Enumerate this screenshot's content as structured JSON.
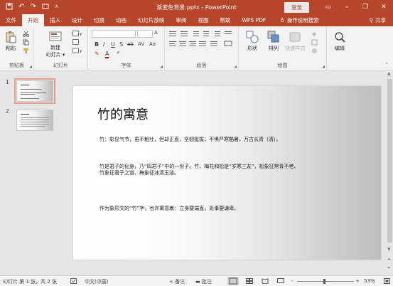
{
  "titlebar": {
    "title": "渐变色背景.pptx - PowerPoint",
    "login_label": "登录",
    "icons": [
      "save-icon",
      "undo-icon",
      "redo-icon",
      "present-icon",
      "customize-icon"
    ],
    "window_buttons": [
      "ribbon-options",
      "minimize",
      "restore",
      "close"
    ]
  },
  "tabs": [
    "文件",
    "开始",
    "插入",
    "设计",
    "切换",
    "动画",
    "幻灯片放映",
    "审阅",
    "视图",
    "帮助",
    "WPS PDF"
  ],
  "active_tab": "开始",
  "search_label": "操作说明搜索",
  "share_label": "共享",
  "ribbon": {
    "clipboard": {
      "paste": "粘贴",
      "label": "剪贴板"
    },
    "slides": {
      "new_slide_line1": "新建",
      "new_slide_line2": "幻灯片 ▾",
      "label": "幻灯片"
    },
    "font": {
      "label": "字体",
      "buttons": [
        "B",
        "I",
        "U",
        "S",
        "ab",
        "AV",
        "Aa",
        "A",
        "A"
      ]
    },
    "paragraph": {
      "label": "段落"
    },
    "drawing": {
      "shapes": "形状",
      "arrange": "排列",
      "quick_styles": "快速样式",
      "label": "绘图"
    },
    "editing": {
      "edit": "编辑"
    }
  },
  "thumbnails": [
    {
      "number": "1",
      "selected": true
    },
    {
      "number": "2",
      "selected": false
    }
  ],
  "slide": {
    "title": "竹的寓意",
    "paragraphs": [
      "竹：彰显气节，虽不粗壮，但却正直，坚韧挺拔；不惧严寒酷暑，万古长青（清）。",
      "竹是君子的化身，乃“四君子”中的一份子。竹、梅花和松是“岁寒三友”，松象征常青不老、",
      "竹象征君子之道、梅象征冰清玉洁。",
      "作为象形文的“竹”字，也许寓意着：立身要端直，处事要谦卑。"
    ]
  },
  "statusbar": {
    "slide_info": "幻灯片 第 1 张，共 2 张",
    "language": "中文(中国)",
    "notes": "备注",
    "comments": "批注",
    "zoom": "53%",
    "zoom_minus": "-",
    "zoom_plus": "+"
  },
  "colors": {
    "accent": "#b7472a",
    "ribbon_bg": "#f3f3f3",
    "workspace_bg": "#e6e6e6"
  }
}
